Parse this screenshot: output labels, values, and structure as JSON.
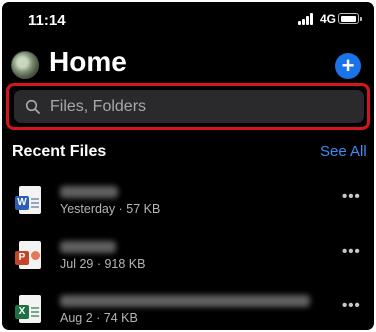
{
  "status_bar": {
    "time": "11:14",
    "network": "4G"
  },
  "header": {
    "title": "Home"
  },
  "search": {
    "placeholder": "Files, Folders"
  },
  "recent": {
    "title": "Recent Files",
    "see_all": "See All",
    "files": [
      {
        "type": "word",
        "badge": "W",
        "meta": "Yesterday · 57 KB",
        "color": "#2b5fb4"
      },
      {
        "type": "powerpoint",
        "badge": "P",
        "meta": "Jul 29 · 918 KB",
        "color": "#c4462a"
      },
      {
        "type": "excel",
        "badge": "X",
        "meta": "Aug 2 · 74 KB",
        "color": "#1e7145"
      }
    ]
  },
  "colors": {
    "accent": "#1a73e8",
    "link": "#3a8ef6",
    "highlight": "#d4161c",
    "background": "#000000"
  }
}
